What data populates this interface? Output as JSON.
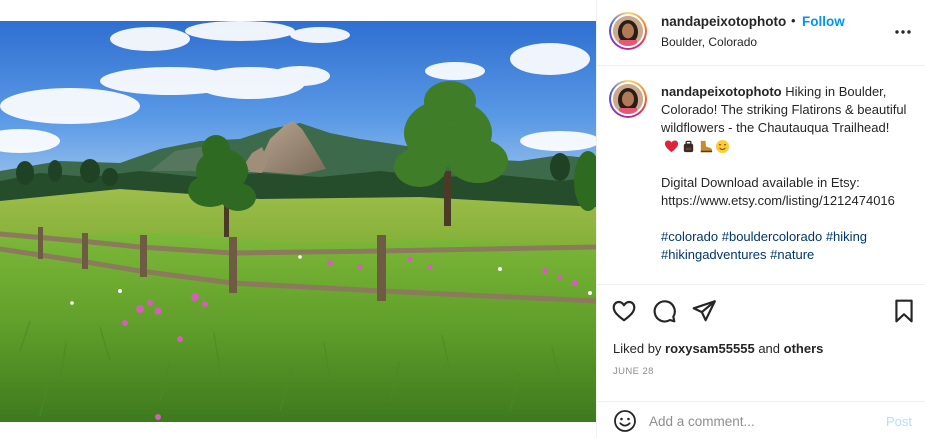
{
  "post": {
    "username": "nandapeixotophoto",
    "separator_dot": "•",
    "follow_label": "Follow",
    "location": "Boulder, Colorado",
    "caption": {
      "username": "nandapeixotophoto",
      "line1": "Hiking in Boulder, Colorado! The striking Flatirons & beautiful wildflowers - the Chautauqua Trailhead!",
      "emojis": [
        "red-heart-emoji",
        "backpack-emoji",
        "hiking-boot-emoji",
        "smiling-face-emoji"
      ],
      "line2": "Digital Download available in Etsy: https://www.etsy.com/listing/1212474016",
      "hashtags": [
        "#colorado",
        "#bouldercolorado",
        "#hiking",
        "#hikingadventures",
        "#nature"
      ]
    },
    "actions": {
      "like_icon": "heart-icon",
      "comment_icon": "comment-icon",
      "share_icon": "share-icon",
      "save_icon": "bookmark-icon",
      "more_icon": "more-options-icon"
    },
    "likes": {
      "prefix": "Liked by",
      "user": "roxysam55555",
      "conjunction": "and",
      "others": "others"
    },
    "date": "JUNE 28",
    "comment_box": {
      "placeholder": "Add a comment...",
      "post_label": "Post",
      "emoji_icon": "emoji-smile-icon"
    }
  },
  "colors": {
    "link_blue": "#0095f6",
    "hashtag_blue": "#00376b",
    "post_disabled": "#b2dffc",
    "muted_text": "#8e8e8e"
  }
}
